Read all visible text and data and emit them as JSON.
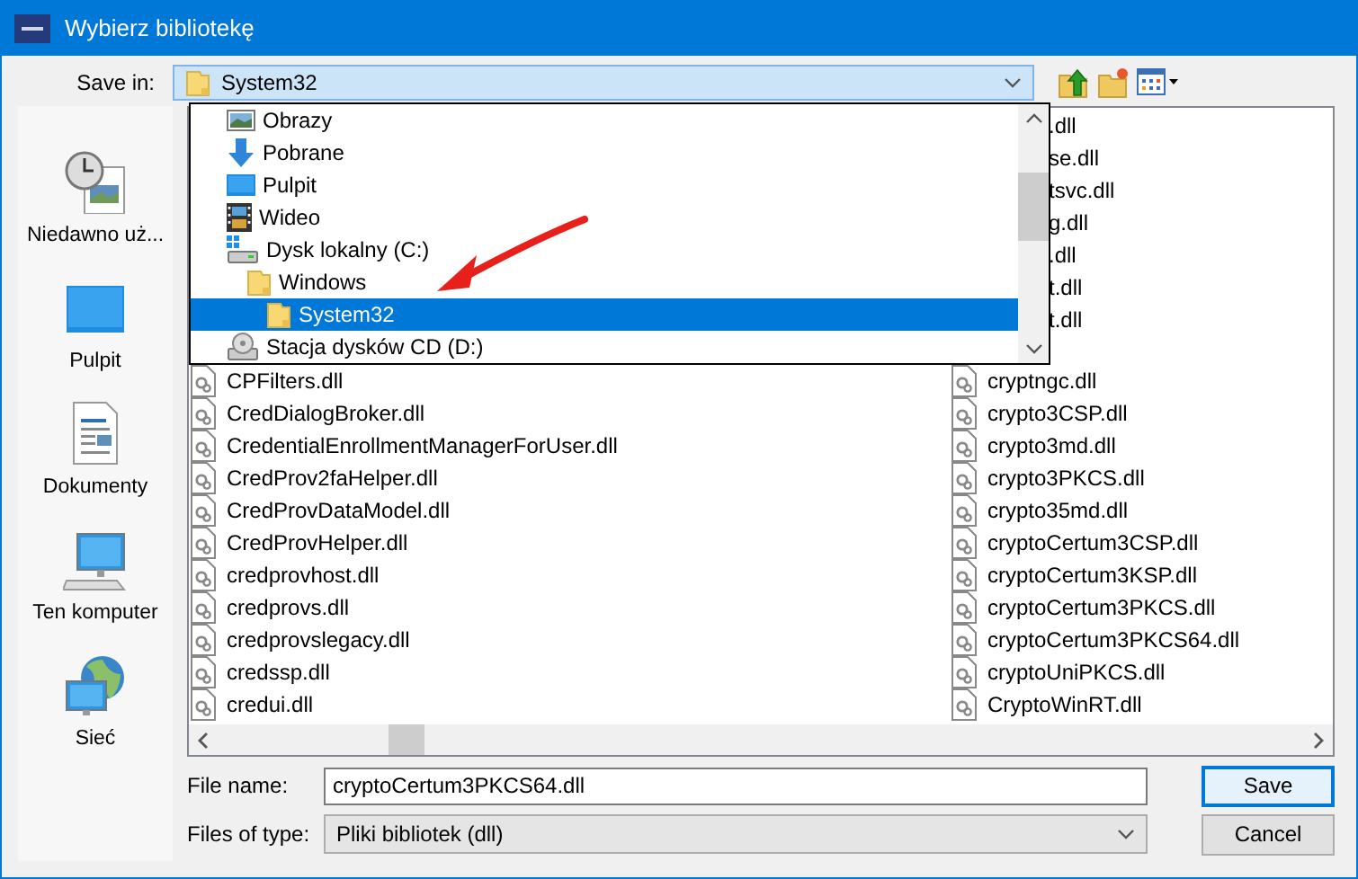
{
  "window": {
    "title": "Wybierz bibliotekę"
  },
  "save_in": {
    "label": "Save in:",
    "value": "System32"
  },
  "location_menu": [
    {
      "label": "Obrazy",
      "kind": "pictures",
      "selected": false
    },
    {
      "label": "Pobrane",
      "kind": "downloads",
      "selected": false
    },
    {
      "label": "Pulpit",
      "kind": "desktop",
      "selected": false
    },
    {
      "label": "Wideo",
      "kind": "videos",
      "selected": false
    },
    {
      "label": "Dysk lokalny (C:)",
      "kind": "drive",
      "selected": false,
      "children": [
        {
          "label": "Windows",
          "kind": "folder",
          "selected": false,
          "children": [
            {
              "label": "System32",
              "kind": "folder",
              "selected": true
            }
          ]
        }
      ]
    },
    {
      "label": "Stacja dysków CD (D:)",
      "kind": "cd",
      "selected": false
    }
  ],
  "sidebar": {
    "items": [
      {
        "label": "Niedawno uż...",
        "kind": "recent"
      },
      {
        "label": "Pulpit",
        "kind": "desktop"
      },
      {
        "label": "Dokumenty",
        "kind": "documents"
      },
      {
        "label": "Ten komputer",
        "kind": "computer"
      },
      {
        "label": "Sieć",
        "kind": "network"
      }
    ]
  },
  "file_list": {
    "column_1": [
      {
        "name": "CPFilters.dll",
        "kind": "file"
      },
      {
        "name": "CredDialogBroker.dll",
        "kind": "file"
      },
      {
        "name": "CredentialEnrollmentManagerForUser.dll",
        "kind": "file"
      },
      {
        "name": "CredProv2faHelper.dll",
        "kind": "file"
      },
      {
        "name": "CredProvDataModel.dll",
        "kind": "file"
      },
      {
        "name": "CredProvHelper.dll",
        "kind": "file"
      },
      {
        "name": "credprovhost.dll",
        "kind": "file"
      },
      {
        "name": "credprovs.dll",
        "kind": "file"
      },
      {
        "name": "credprovslegacy.dll",
        "kind": "file"
      },
      {
        "name": "credssp.dll",
        "kind": "file"
      },
      {
        "name": "credui.dll",
        "kind": "file"
      }
    ],
    "column_2": [
      {
        "name": ".dll",
        "kind": "cut"
      },
      {
        "name": "se.dll",
        "kind": "cut"
      },
      {
        "name": "tsvc.dll",
        "kind": "cut"
      },
      {
        "name": "g.dll",
        "kind": "cut"
      },
      {
        "name": ".dll",
        "kind": "cut"
      },
      {
        "name": "t.dll",
        "kind": "cut"
      },
      {
        "name": "t.dll",
        "kind": "cut"
      },
      {
        "name": "cryptngc.dll",
        "kind": "file"
      },
      {
        "name": "crypto3CSP.dll",
        "kind": "file"
      },
      {
        "name": "crypto3md.dll",
        "kind": "file"
      },
      {
        "name": "crypto3PKCS.dll",
        "kind": "file"
      },
      {
        "name": "crypto35md.dll",
        "kind": "file"
      },
      {
        "name": "cryptoCertum3CSP.dll",
        "kind": "file"
      },
      {
        "name": "cryptoCertum3KSP.dll",
        "kind": "file"
      },
      {
        "name": "cryptoCertum3PKCS.dll",
        "kind": "file"
      },
      {
        "name": "cryptoCertum3PKCS64.dll",
        "kind": "file"
      },
      {
        "name": "cryptoUniPKCS.dll",
        "kind": "file"
      },
      {
        "name": "CryptoWinRT.dll",
        "kind": "file"
      }
    ]
  },
  "file_name": {
    "label": "File name:",
    "value": "cryptoCertum3PKCS64.dll"
  },
  "file_type": {
    "label": "Files of type:",
    "value": "Pliki bibliotek (dll)"
  },
  "buttons": [
    {
      "label": "Save",
      "default": true
    },
    {
      "label": "Cancel",
      "default": false
    }
  ]
}
